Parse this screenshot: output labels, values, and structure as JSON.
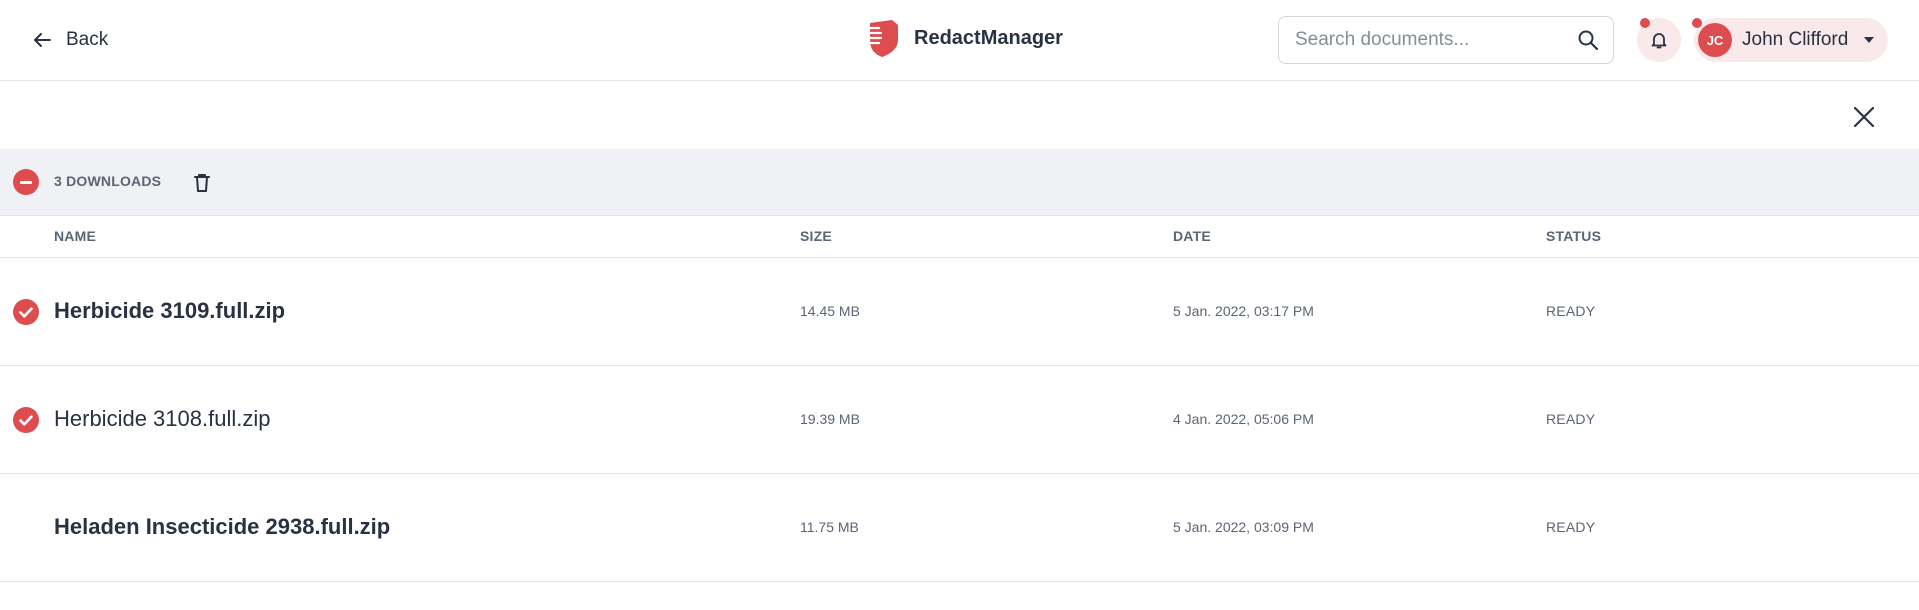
{
  "header": {
    "back_label": "Back",
    "app_name": "RedactManager",
    "search_placeholder": "Search documents...",
    "user": {
      "initials": "JC",
      "name": "John Clifford"
    }
  },
  "downloads": {
    "selected_count_label": "3 DOWNLOADS",
    "columns": {
      "name": "NAME",
      "size": "SIZE",
      "date": "DATE",
      "status": "STATUS"
    },
    "rows": [
      {
        "name": "Herbicide 3109.full.zip",
        "size": "14.45 MB",
        "date": "5 Jan. 2022, 03:17 PM",
        "status": "READY",
        "selected": true,
        "unread": true
      },
      {
        "name": "Herbicide 3108.full.zip",
        "size": "19.39 MB",
        "date": "4 Jan. 2022, 05:06 PM",
        "status": "READY",
        "selected": true,
        "unread": false
      },
      {
        "name": "Heladen Insecticide 2938.full.zip",
        "size": "11.75 MB",
        "date": "5 Jan. 2022, 03:09 PM",
        "status": "READY",
        "selected": false,
        "unread": true
      }
    ]
  },
  "colors": {
    "accent": "#dd4d50",
    "text": "#283241",
    "muted": "#5b6573",
    "bar_bg": "#f0f1f4"
  },
  "icons": [
    "arrow-left-icon",
    "logo-shield-icon",
    "search-icon",
    "bell-icon",
    "caret-down-icon",
    "close-icon",
    "deselect-icon",
    "trash-icon",
    "check-icon"
  ]
}
